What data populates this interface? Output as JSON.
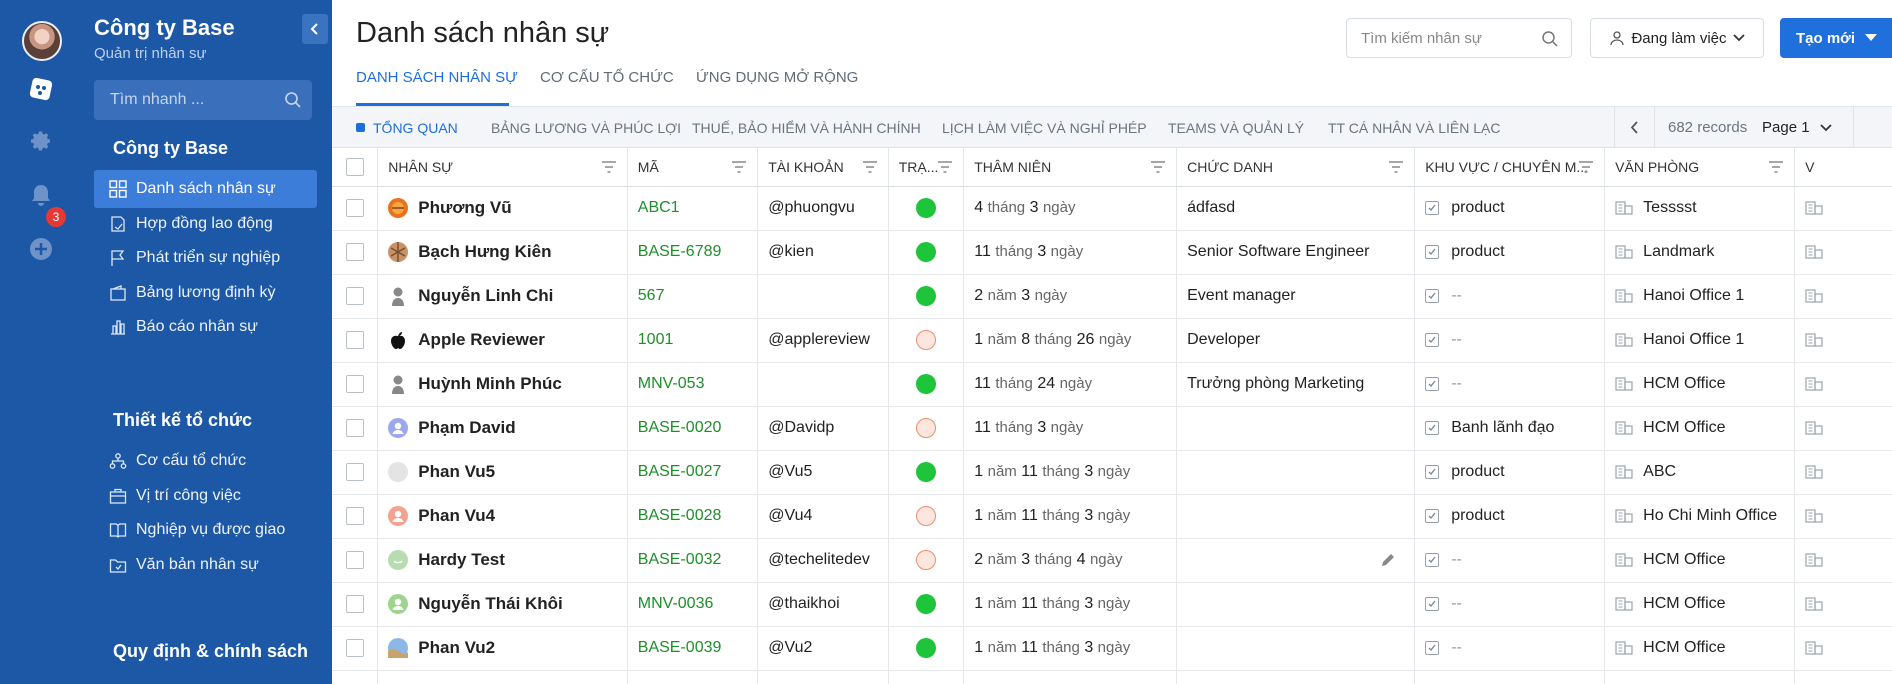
{
  "company": {
    "name": "Công ty Base",
    "subtitle": "Quản trị nhân sự"
  },
  "rail": {
    "notification_count": "3"
  },
  "quick_search": {
    "placeholder": "Tìm nhanh ..."
  },
  "nav": {
    "section1": "Công ty Base",
    "section1_items": [
      {
        "label": "Danh sách nhân sự",
        "icon": "grid-icon",
        "active": true
      },
      {
        "label": "Hợp đồng lao động",
        "icon": "contract-icon"
      },
      {
        "label": "Phát triển sự nghiệp",
        "icon": "flag-icon"
      },
      {
        "label": "Bảng lương định kỳ",
        "icon": "wallet-icon"
      },
      {
        "label": "Báo cáo nhân sự",
        "icon": "report-icon"
      }
    ],
    "section2": "Thiết kế tổ chức",
    "section2_items": [
      {
        "label": "Cơ cấu tổ chức",
        "icon": "org-chart-icon"
      },
      {
        "label": "Vị trí công việc",
        "icon": "briefcase-icon"
      },
      {
        "label": "Nghiệp vụ được giao",
        "icon": "book-icon"
      },
      {
        "label": "Văn bản nhân sự",
        "icon": "folder-icon"
      }
    ],
    "section3": "Quy định & chính sách"
  },
  "header": {
    "title": "Danh sách nhân sự",
    "search_placeholder": "Tìm kiếm nhân sự",
    "status_filter": "Đang làm việc",
    "create_button": "Tạo mới"
  },
  "main_tabs": [
    "DANH SÁCH NHÂN SỰ",
    "CƠ CẤU TỔ CHỨC",
    "ỨNG DỤNG MỞ RỘNG"
  ],
  "sub_tabs": [
    "TỔNG QUAN",
    "BẢNG LƯƠNG VÀ PHÚC LỢI",
    "THUẾ, BẢO HIỂM VÀ HÀNH CHÍNH",
    "LỊCH LÀM VIỆC VÀ NGHỈ PHÉP",
    "TEAMS VÀ QUẢN LÝ",
    "TT CÁ NHÂN VÀ LIÊN LẠC"
  ],
  "pager": {
    "records": "682 records",
    "page": "Page 1"
  },
  "columns": [
    "NHÂN SỰ",
    "MÃ",
    "TÀI KHOẢN",
    "TRẠ...",
    "THÂM NIÊN",
    "CHỨC DANH",
    "KHU VỰC / CHUYÊN M...",
    "VĂN PHÒNG",
    "V"
  ],
  "rows": [
    {
      "name": "Phương Vũ",
      "avatar": "orange-ball",
      "code": "ABC1",
      "account": "@phuongvu",
      "status": "active",
      "tenure": [
        [
          "4",
          "tháng"
        ],
        [
          "3",
          "ngày"
        ]
      ],
      "title": "ádfasd",
      "area": "product",
      "office": "Tesssst"
    },
    {
      "name": "Bạch Hưng Kiên",
      "avatar": "pattern",
      "code": "BASE-6789",
      "account": "@kien",
      "status": "active",
      "tenure": [
        [
          "11",
          "tháng"
        ],
        [
          "3",
          "ngày"
        ]
      ],
      "title": "Senior Software Engineer",
      "area": "product",
      "office": "Landmark"
    },
    {
      "name": "Nguyễn Linh Chi",
      "avatar": "grey-person",
      "code": "567",
      "account": "",
      "status": "active",
      "tenure": [
        [
          "2",
          "năm"
        ],
        [
          "3",
          "ngày"
        ]
      ],
      "title": "Event manager",
      "area": "--",
      "office": "Hanoi Office 1"
    },
    {
      "name": "Apple Reviewer",
      "avatar": "apple",
      "code": "1001",
      "account": "@applereview",
      "status": "inactive",
      "tenure": [
        [
          "1",
          "năm"
        ],
        [
          "8",
          "tháng"
        ],
        [
          "26",
          "ngày"
        ]
      ],
      "title": "Developer",
      "area": "--",
      "office": "Hanoi Office 1"
    },
    {
      "name": "Huỳnh Minh Phúc",
      "avatar": "grey-person",
      "code": "MNV-053",
      "account": "",
      "status": "active",
      "tenure": [
        [
          "11",
          "tháng"
        ],
        [
          "24",
          "ngày"
        ]
      ],
      "title": "Trưởng phòng Marketing",
      "area": "--",
      "office": "HCM Office"
    },
    {
      "name": "Phạm David",
      "avatar": "purple-person",
      "code": "BASE-0020",
      "account": "@Davidp",
      "status": "inactive",
      "tenure": [
        [
          "11",
          "tháng"
        ],
        [
          "3",
          "ngày"
        ]
      ],
      "title": "",
      "area": "Banh lãnh đạo",
      "office": "HCM Office"
    },
    {
      "name": "Phan Vu5",
      "avatar": "light-grey",
      "code": "BASE-0027",
      "account": "@Vu5",
      "status": "active",
      "tenure": [
        [
          "1",
          "năm"
        ],
        [
          "11",
          "tháng"
        ],
        [
          "3",
          "ngày"
        ]
      ],
      "title": "",
      "area": "product",
      "office": "ABC"
    },
    {
      "name": "Phan Vu4",
      "avatar": "salmon-person",
      "code": "BASE-0028",
      "account": "@Vu4",
      "status": "inactive",
      "tenure": [
        [
          "1",
          "năm"
        ],
        [
          "11",
          "tháng"
        ],
        [
          "3",
          "ngày"
        ]
      ],
      "title": "",
      "area": "product",
      "office": "Ho Chi Minh Office"
    },
    {
      "name": "Hardy Test",
      "avatar": "green-face",
      "code": "BASE-0032",
      "account": "@techelitedev",
      "status": "inactive",
      "tenure": [
        [
          "2",
          "năm"
        ],
        [
          "3",
          "tháng"
        ],
        [
          "4",
          "ngày"
        ]
      ],
      "title": "",
      "area": "--",
      "office": "HCM Office",
      "editable": true
    },
    {
      "name": "Nguyễn Thái Khôi",
      "avatar": "green-person",
      "code": "MNV-0036",
      "account": "@thaikhoi",
      "status": "active",
      "tenure": [
        [
          "1",
          "năm"
        ],
        [
          "11",
          "tháng"
        ],
        [
          "3",
          "ngày"
        ]
      ],
      "title": "",
      "area": "--",
      "office": "HCM Office"
    },
    {
      "name": "Phan Vu2",
      "avatar": "landscape",
      "code": "BASE-0039",
      "account": "@Vu2",
      "status": "active",
      "tenure": [
        [
          "1",
          "năm"
        ],
        [
          "11",
          "tháng"
        ],
        [
          "3",
          "ngày"
        ]
      ],
      "title": "",
      "area": "--",
      "office": "HCM Office"
    }
  ],
  "colors": {
    "sidebar": "#1c58a6",
    "accent": "#1e6fd9",
    "code_green": "#1d8f2a",
    "status_active": "#1ec53b",
    "status_inactive": "#f08c6c"
  }
}
